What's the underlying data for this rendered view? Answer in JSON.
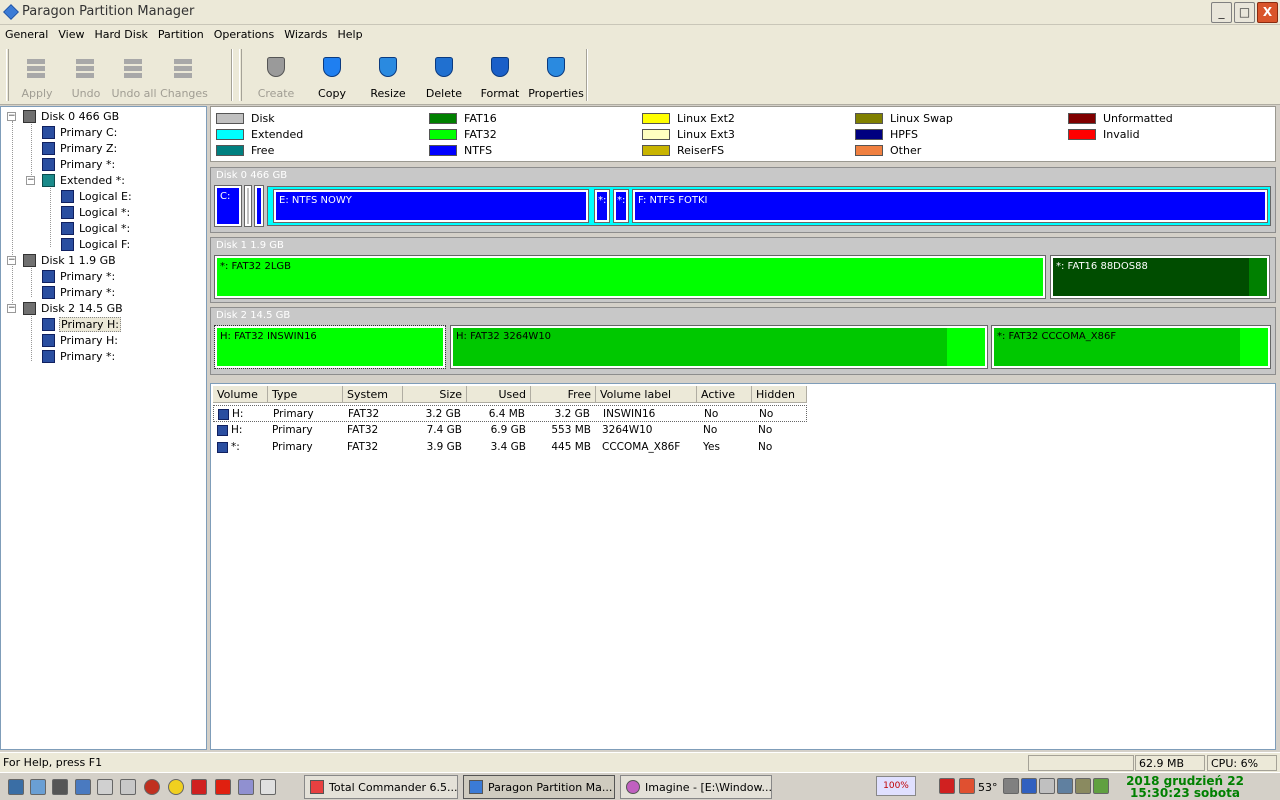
{
  "window": {
    "title": "Paragon Partition Manager",
    "min": "_",
    "max": "□",
    "close": "X"
  },
  "menu": [
    "General",
    "View",
    "Hard Disk",
    "Partition",
    "Operations",
    "Wizards",
    "Help"
  ],
  "toolbar": {
    "apply": "Apply",
    "undo": "Undo",
    "undo_all": "Undo all",
    "changes": "Changes",
    "create": "Create",
    "copy": "Copy",
    "resize": "Resize",
    "delete": "Delete",
    "format": "Format",
    "properties": "Properties"
  },
  "tree": {
    "disk0": "Disk 0 466 GB",
    "primary_c": "Primary C:",
    "primary_z": "Primary Z:",
    "primary_star": "Primary *:",
    "extended": "Extended *:",
    "logical_e": "Logical E:",
    "logical_s1": "Logical *:",
    "logical_s2": "Logical *:",
    "logical_f": "Logical F:",
    "disk1": "Disk 1 1.9 GB",
    "d1_p1": "Primary *:",
    "d1_p2": "Primary *:",
    "disk2": "Disk 2 14.5 GB",
    "d2_p1": "Primary H:",
    "d2_p2": "Primary H:",
    "d2_p3": "Primary *:"
  },
  "legend": [
    {
      "label": "Disk",
      "color": "#c0c0c0"
    },
    {
      "label": "Extended",
      "color": "#00ffff"
    },
    {
      "label": "Free",
      "color": "#008080"
    },
    {
      "label": "FAT16",
      "color": "#008000"
    },
    {
      "label": "FAT32",
      "color": "#00ff00"
    },
    {
      "label": "NTFS",
      "color": "#0000ff"
    },
    {
      "label": "Linux Ext2",
      "color": "#ffff00"
    },
    {
      "label": "Linux Ext3",
      "color": "#ffffc0"
    },
    {
      "label": "ReiserFS",
      "color": "#c8b400"
    },
    {
      "label": "Linux Swap",
      "color": "#808000"
    },
    {
      "label": "HPFS",
      "color": "#000080"
    },
    {
      "label": "Other",
      "color": "#f08040"
    },
    {
      "label": "Unformatted",
      "color": "#800000"
    },
    {
      "label": "Invalid",
      "color": "#ff0000"
    }
  ],
  "disks": {
    "d0": {
      "header": "Disk 0 466 GB",
      "c": "C:",
      "e": "E:  NTFS  NOWY",
      "s1": "*:",
      "s2": "*:",
      "f": "F:  NTFS  FOTKI"
    },
    "d1": {
      "header": "Disk 1 1.9 GB",
      "p1": "*:  FAT32  2LGB",
      "p2": "*:  FAT16  88DOS88"
    },
    "d2": {
      "header": "Disk 2 14.5 GB",
      "p1": "H:  FAT32  INSWIN16",
      "p2": "H:  FAT32  3264W10",
      "p3": "*:  FAT32  CCCOMA_X86F"
    }
  },
  "table": {
    "headers": [
      "Volume",
      "Type",
      "System",
      "Size",
      "Used",
      "Free",
      "Volume label",
      "Active",
      "Hidden"
    ],
    "rows": [
      [
        "H:",
        "Primary",
        "FAT32",
        "3.2 GB",
        "6.4 MB",
        "3.2 GB",
        "INSWIN16",
        "No",
        "No"
      ],
      [
        "H:",
        "Primary",
        "FAT32",
        "7.4 GB",
        "6.9 GB",
        "553 MB",
        "3264W10",
        "No",
        "No"
      ],
      [
        "*:",
        "Primary",
        "FAT32",
        "3.9 GB",
        "3.4 GB",
        "445 MB",
        "CCCOMA_X86F",
        "Yes",
        "No"
      ]
    ]
  },
  "status": {
    "help": "For Help, press F1",
    "mem": "62.9 MB",
    "cpu": "CPU: 6%"
  },
  "taskbar": {
    "tasks": [
      "Total Commander 6.5...",
      "Paragon Partition Ma...",
      "Imagine - [E:\\Window..."
    ],
    "zoom": "100%",
    "temp": "53°",
    "clock_line1": "2018 grudzień 22",
    "clock_line2": "15:30:23 sobota"
  }
}
